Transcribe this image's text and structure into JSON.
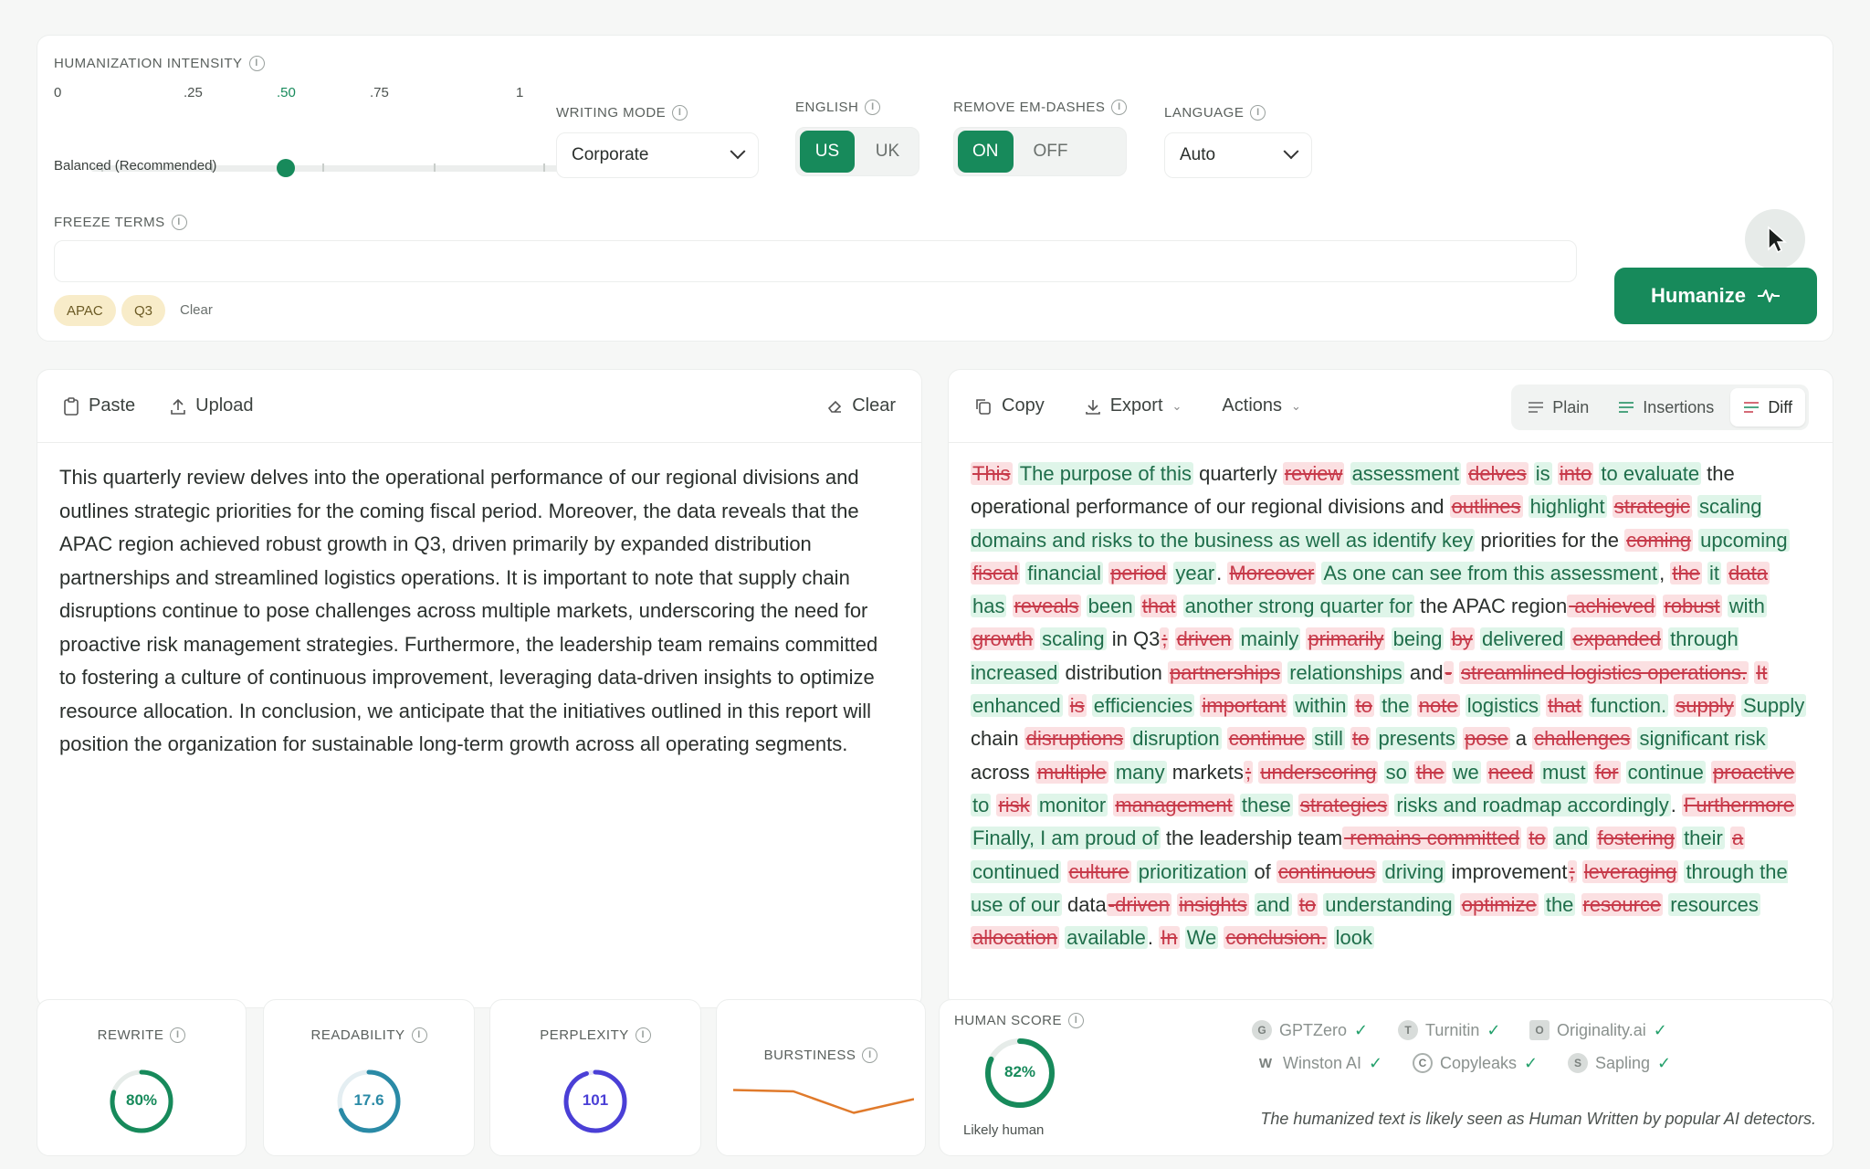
{
  "settings": {
    "intensity_label": "HUMANIZATION INTENSITY",
    "ticks": [
      "0",
      ".25",
      ".50",
      ".75",
      "1"
    ],
    "intensity_value": 0.5,
    "intensity_caption": "Balanced (Recommended)",
    "writing_mode_label": "WRITING MODE",
    "writing_mode_value": "Corporate",
    "english_label": "ENGLISH",
    "english_options": [
      "US",
      "UK"
    ],
    "english_selected": "US",
    "emdash_label": "REMOVE EM-DASHES",
    "emdash_options": [
      "ON",
      "OFF"
    ],
    "emdash_selected": "ON",
    "language_label": "LANGUAGE",
    "language_value": "Auto",
    "freeze_label": "FREEZE TERMS",
    "freeze_chips": [
      "APAC",
      "Q3"
    ],
    "freeze_clear": "Clear",
    "humanize_button": "Humanize"
  },
  "input": {
    "paste": "Paste",
    "upload": "Upload",
    "clear": "Clear",
    "text": "This quarterly review delves into the operational performance of our regional divisions and outlines strategic priorities for the coming fiscal period. Moreover, the data reveals that the APAC region achieved robust growth in Q3, driven primarily by expanded distribution partnerships and streamlined logistics operations. It is important to note that supply chain disruptions continue to pose challenges across multiple markets, underscoring the need for proactive risk management strategies. Furthermore, the leadership team remains committed to fostering a culture of continuous improvement, leveraging data-driven insights to optimize resource allocation. In conclusion, we anticipate that the initiatives outlined in this report will position the organization for sustainable long-term growth across all operating segments."
  },
  "output": {
    "copy": "Copy",
    "export": "Export",
    "actions": "Actions",
    "view_tabs": [
      "Plain",
      "Insertions",
      "Diff"
    ],
    "view_selected": "Diff",
    "diff": [
      [
        "d",
        "This"
      ],
      [
        "s",
        " "
      ],
      [
        "a",
        "The purpose of this"
      ],
      [
        "s",
        " quarterly "
      ],
      [
        "d",
        "review"
      ],
      [
        "s",
        " "
      ],
      [
        "a",
        "assessment"
      ],
      [
        "s",
        " "
      ],
      [
        "d",
        "delves"
      ],
      [
        "s",
        " "
      ],
      [
        "a",
        "is"
      ],
      [
        "s",
        " "
      ],
      [
        "d",
        "into"
      ],
      [
        "s",
        " "
      ],
      [
        "a",
        "to evaluate"
      ],
      [
        "s",
        " the operational performance of our regional divisions and "
      ],
      [
        "d",
        "outlines"
      ],
      [
        "s",
        " "
      ],
      [
        "a",
        "highlight"
      ],
      [
        "s",
        " "
      ],
      [
        "d",
        "strategic"
      ],
      [
        "s",
        " "
      ],
      [
        "a",
        "scaling domains and risks to the business as well as identify key"
      ],
      [
        "s",
        " priorities for the "
      ],
      [
        "d",
        "coming"
      ],
      [
        "s",
        " "
      ],
      [
        "a",
        "upcoming"
      ],
      [
        "s",
        " "
      ],
      [
        "d",
        "fiscal"
      ],
      [
        "s",
        " "
      ],
      [
        "a",
        "financial"
      ],
      [
        "s",
        " "
      ],
      [
        "d",
        "period"
      ],
      [
        "s",
        " "
      ],
      [
        "a",
        "year"
      ],
      [
        "s",
        "."
      ],
      [
        "s",
        " "
      ],
      [
        "d",
        "Moreover"
      ],
      [
        "s",
        " "
      ],
      [
        "a",
        "As one can see from this assessment"
      ],
      [
        "s",
        ", "
      ],
      [
        "d",
        "the"
      ],
      [
        "s",
        " "
      ],
      [
        "a",
        "it"
      ],
      [
        "s",
        " "
      ],
      [
        "d",
        "data"
      ],
      [
        "s",
        " "
      ],
      [
        "a",
        "has"
      ],
      [
        "s",
        " "
      ],
      [
        "d",
        "reveals"
      ],
      [
        "s",
        " "
      ],
      [
        "a",
        "been"
      ],
      [
        "s",
        " "
      ],
      [
        "d",
        "that"
      ],
      [
        "s",
        " "
      ],
      [
        "a",
        "another strong quarter for"
      ],
      [
        "s",
        " the APAC region"
      ],
      [
        "d",
        " achieved"
      ],
      [
        "s",
        " "
      ],
      [
        "d",
        "robust"
      ],
      [
        "s",
        " "
      ],
      [
        "a",
        "with"
      ],
      [
        "s",
        " "
      ],
      [
        "d",
        "growth"
      ],
      [
        "s",
        " "
      ],
      [
        "a",
        "scaling"
      ],
      [
        "s",
        " in Q3"
      ],
      [
        "d",
        ";"
      ],
      [
        "s",
        " "
      ],
      [
        "d",
        "driven"
      ],
      [
        "s",
        " "
      ],
      [
        "a",
        "mainly"
      ],
      [
        "s",
        " "
      ],
      [
        "d",
        "primarily"
      ],
      [
        "s",
        " "
      ],
      [
        "a",
        "being"
      ],
      [
        "s",
        " "
      ],
      [
        "d",
        "by"
      ],
      [
        "s",
        " "
      ],
      [
        "a",
        "delivered"
      ],
      [
        "s",
        " "
      ],
      [
        "d",
        "expanded"
      ],
      [
        "s",
        " "
      ],
      [
        "a",
        "through increased"
      ],
      [
        "s",
        " distribution "
      ],
      [
        "d",
        "partnerships"
      ],
      [
        "s",
        " "
      ],
      [
        "a",
        "relationships"
      ],
      [
        "s",
        " and"
      ],
      [
        "d",
        "-"
      ],
      [
        "s",
        " "
      ],
      [
        "d",
        "streamlined logistics operations."
      ],
      [
        "s",
        " "
      ],
      [
        "d",
        "It"
      ],
      [
        "s",
        " "
      ],
      [
        "a",
        "enhanced"
      ],
      [
        "s",
        " "
      ],
      [
        "d",
        "is"
      ],
      [
        "s",
        " "
      ],
      [
        "a",
        "efficiencies"
      ],
      [
        "s",
        " "
      ],
      [
        "d",
        "important"
      ],
      [
        "s",
        " "
      ],
      [
        "a",
        "within"
      ],
      [
        "s",
        " "
      ],
      [
        "d",
        "to"
      ],
      [
        "s",
        " "
      ],
      [
        "a",
        "the"
      ],
      [
        "s",
        " "
      ],
      [
        "d",
        "note"
      ],
      [
        "s",
        " "
      ],
      [
        "a",
        "logistics"
      ],
      [
        "s",
        " "
      ],
      [
        "d",
        "that"
      ],
      [
        "s",
        " "
      ],
      [
        "a",
        "function."
      ],
      [
        "s",
        " "
      ],
      [
        "d",
        "supply"
      ],
      [
        "s",
        " "
      ],
      [
        "a",
        "Supply"
      ],
      [
        "s",
        " chain "
      ],
      [
        "d",
        "disruptions"
      ],
      [
        "s",
        " "
      ],
      [
        "a",
        "disruption"
      ],
      [
        "s",
        " "
      ],
      [
        "d",
        "continue"
      ],
      [
        "s",
        " "
      ],
      [
        "a",
        "still"
      ],
      [
        "s",
        " "
      ],
      [
        "d",
        "to"
      ],
      [
        "s",
        " "
      ],
      [
        "a",
        "presents"
      ],
      [
        "s",
        " "
      ],
      [
        "d",
        "pose"
      ],
      [
        "s",
        " a "
      ],
      [
        "d",
        "challenges"
      ],
      [
        "s",
        " "
      ],
      [
        "a",
        "significant risk"
      ],
      [
        "s",
        " across "
      ],
      [
        "d",
        "multiple"
      ],
      [
        "s",
        " "
      ],
      [
        "a",
        "many"
      ],
      [
        "s",
        " markets"
      ],
      [
        "d",
        ";"
      ],
      [
        "s",
        " "
      ],
      [
        "d",
        "underscoring"
      ],
      [
        "s",
        " "
      ],
      [
        "a",
        "so"
      ],
      [
        "s",
        " "
      ],
      [
        "d",
        "the"
      ],
      [
        "s",
        " "
      ],
      [
        "a",
        "we"
      ],
      [
        "s",
        " "
      ],
      [
        "d",
        "need"
      ],
      [
        "s",
        " "
      ],
      [
        "a",
        "must"
      ],
      [
        "s",
        " "
      ],
      [
        "d",
        "for"
      ],
      [
        "s",
        " "
      ],
      [
        "a",
        "continue"
      ],
      [
        "s",
        " "
      ],
      [
        "d",
        "proactive"
      ],
      [
        "s",
        " "
      ],
      [
        "a",
        "to"
      ],
      [
        "s",
        " "
      ],
      [
        "d",
        "risk"
      ],
      [
        "s",
        " "
      ],
      [
        "a",
        "monitor"
      ],
      [
        "s",
        " "
      ],
      [
        "d",
        "management"
      ],
      [
        "s",
        " "
      ],
      [
        "a",
        "these"
      ],
      [
        "s",
        " "
      ],
      [
        "d",
        "strategies"
      ],
      [
        "s",
        " "
      ],
      [
        "a",
        "risks and roadmap accordingly"
      ],
      [
        "s",
        "."
      ],
      [
        "s",
        " "
      ],
      [
        "d",
        "Furthermore"
      ],
      [
        "s",
        " "
      ],
      [
        "a",
        "Finally, I am proud of"
      ],
      [
        "s",
        " the leadership team"
      ],
      [
        "d",
        " remains committed"
      ],
      [
        "s",
        " "
      ],
      [
        "d",
        "to"
      ],
      [
        "s",
        " "
      ],
      [
        "a",
        "and"
      ],
      [
        "s",
        " "
      ],
      [
        "d",
        "fostering"
      ],
      [
        "s",
        " "
      ],
      [
        "a",
        "their"
      ],
      [
        "s",
        " "
      ],
      [
        "d",
        "a"
      ],
      [
        "s",
        " "
      ],
      [
        "a",
        "continued"
      ],
      [
        "s",
        " "
      ],
      [
        "d",
        "culture"
      ],
      [
        "s",
        " "
      ],
      [
        "a",
        "prioritization"
      ],
      [
        "s",
        " of "
      ],
      [
        "d",
        "continuous"
      ],
      [
        "s",
        " "
      ],
      [
        "a",
        "driving"
      ],
      [
        "s",
        " improvement"
      ],
      [
        "d",
        ";"
      ],
      [
        "s",
        " "
      ],
      [
        "d",
        "leveraging"
      ],
      [
        "s",
        " "
      ],
      [
        "a",
        "through the use of our"
      ],
      [
        "s",
        " data"
      ],
      [
        "d",
        "-driven"
      ],
      [
        "s",
        " "
      ],
      [
        "d",
        "insights"
      ],
      [
        "s",
        " "
      ],
      [
        "a",
        "and"
      ],
      [
        "s",
        " "
      ],
      [
        "d",
        "to"
      ],
      [
        "s",
        " "
      ],
      [
        "a",
        "understanding"
      ],
      [
        "s",
        " "
      ],
      [
        "d",
        "optimize"
      ],
      [
        "s",
        " "
      ],
      [
        "a",
        "the"
      ],
      [
        "s",
        " "
      ],
      [
        "d",
        "resource"
      ],
      [
        "s",
        " "
      ],
      [
        "a",
        "resources"
      ],
      [
        "s",
        " "
      ],
      [
        "d",
        "allocation"
      ],
      [
        "s",
        " "
      ],
      [
        "a",
        "available"
      ],
      [
        "s",
        "."
      ],
      [
        "s",
        " "
      ],
      [
        "d",
        "In"
      ],
      [
        "s",
        " "
      ],
      [
        "a",
        "We"
      ],
      [
        "s",
        " "
      ],
      [
        "d",
        "conclusion."
      ],
      [
        "s",
        " "
      ],
      [
        "a",
        "look"
      ]
    ]
  },
  "stats": {
    "rewrite": {
      "label": "REWRITE",
      "value": "80%",
      "percent": 80,
      "color": "#178a5b"
    },
    "readability": {
      "label": "READABILITY",
      "value": "17.6",
      "percent": 70,
      "color": "#2a8aa6"
    },
    "perplexity": {
      "label": "PERPLEXITY",
      "value": "101",
      "percent": 95,
      "color": "#4a3fd6"
    },
    "burstiness": {
      "label": "BURSTINESS",
      "series": [
        0.75,
        0.72,
        0.25,
        0.55
      ],
      "color": "#e07a2b"
    },
    "human": {
      "label": "HUMAN SCORE",
      "value": "82%",
      "percent": 82,
      "caption": "Likely human",
      "detectors": [
        "GPTZero",
        "Turnitin",
        "Originality.ai",
        "Winston AI",
        "Copyleaks",
        "Sapling"
      ],
      "note": "The humanized text is likely seen as Human Written by popular AI detectors."
    }
  }
}
